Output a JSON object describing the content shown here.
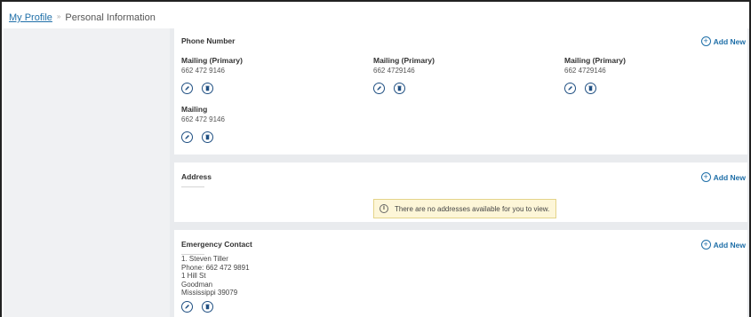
{
  "breadcrumb": {
    "link": "My Profile",
    "separator": "»",
    "current": "Personal Information"
  },
  "phone": {
    "title": "Phone Number",
    "add_new": "Add New",
    "items": [
      {
        "type": "Mailing (Primary)",
        "number": "662 472 9146"
      },
      {
        "type": "Mailing (Primary)",
        "number": "662 4729146"
      },
      {
        "type": "Mailing (Primary)",
        "number": "662 4729146"
      },
      {
        "type": "Mailing",
        "number": "662 472 9146"
      }
    ]
  },
  "address": {
    "title": "Address",
    "add_new": "Add New",
    "notice_icon": "i",
    "notice": "There are no addresses available for you to view."
  },
  "emergency": {
    "title": "Emergency Contact",
    "add_new": "Add New",
    "lines": [
      "1. Steven Tiller",
      "Phone: 662 472 9891",
      "1 Hill St",
      "Goodman",
      "Mississippi 39079"
    ]
  },
  "icons": {
    "plus": "+",
    "edit": "pencil-icon",
    "delete": "trash-icon"
  },
  "colors": {
    "link": "#1f6fa8",
    "icon": "#1f4f82",
    "notice_bg": "#fdf6d8"
  }
}
